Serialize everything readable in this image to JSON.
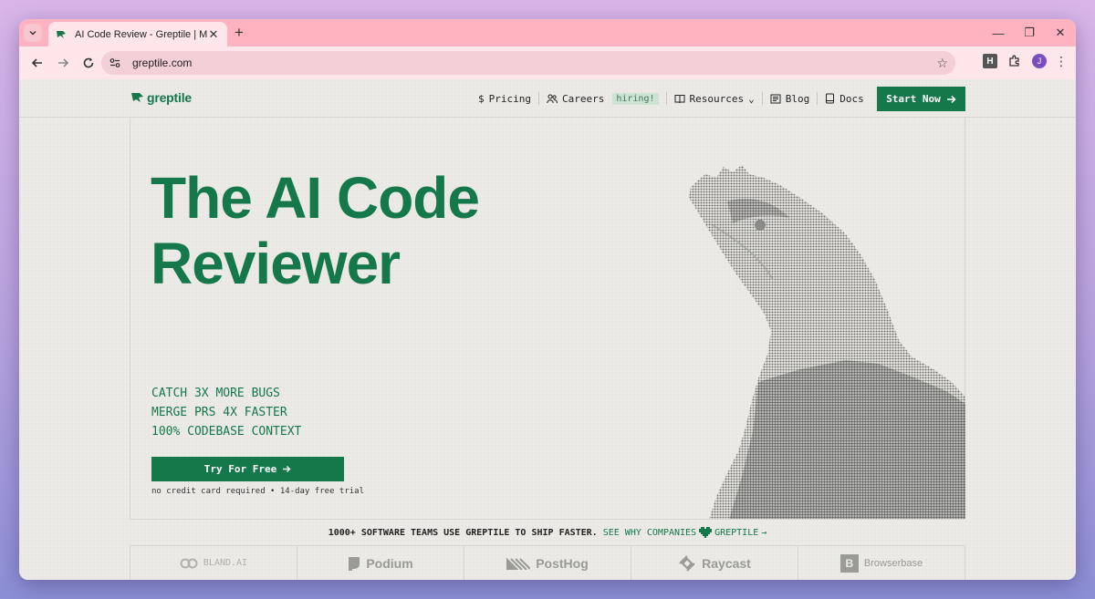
{
  "browser": {
    "tab": {
      "title": "AI Code Review - Greptile | Merge",
      "close": "✕"
    },
    "new_tab": "+",
    "address": {
      "url": "greptile.com"
    },
    "extension_label": "H",
    "profile_initial": "J",
    "window_controls": {
      "minimize": "—",
      "restore": "❐",
      "close": "✕"
    }
  },
  "site": {
    "logo_text": "greptile",
    "nav": [
      {
        "label": "Pricing",
        "icon": "dollar-icon"
      },
      {
        "label": "Careers",
        "icon": "people-icon",
        "badge": "hiring!"
      },
      {
        "label": "Resources",
        "icon": "book-icon",
        "dropdown": true
      },
      {
        "label": "Blog",
        "icon": "newspaper-icon"
      },
      {
        "label": "Docs",
        "icon": "docs-icon"
      }
    ],
    "nav_icon_glyphs": {
      "pricing": "$",
      "dropdown": "⌄"
    },
    "start_button": "Start Now"
  },
  "hero": {
    "title_line1": "The AI Code",
    "title_line2": "Reviewer",
    "features": [
      "CATCH 3X MORE BUGS",
      "MERGE PRS 4X FASTER",
      "100% CODEBASE CONTEXT"
    ],
    "cta": "Try For Free",
    "fine_print": "no credit card required • 14-day free trial"
  },
  "trust": {
    "text": "1000+ SOFTWARE TEAMS USE GREPTILE TO SHIP FASTER.",
    "cta_prefix": "SEE WHY COMPANIES",
    "cta_suffix": "GREPTILE",
    "arrow": "→"
  },
  "customers": [
    {
      "name": "BLAND.AI"
    },
    {
      "name": "Podium"
    },
    {
      "name": "PostHog"
    },
    {
      "name": "Raycast"
    },
    {
      "name": "Browserbase",
      "mark": "B"
    }
  ],
  "colors": {
    "brand_green": "#15784b",
    "tab_bar": "#ffb3c1",
    "toolbar": "#ffe6eb",
    "page_bg": "#ebeae6"
  }
}
